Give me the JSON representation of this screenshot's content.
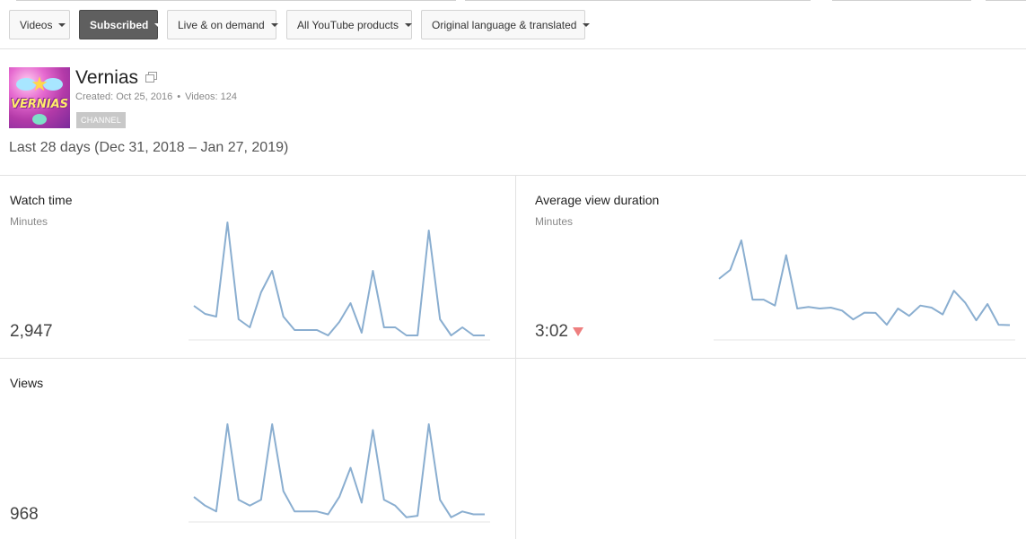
{
  "filters": [
    {
      "label": "Videos",
      "active": false
    },
    {
      "label": "Subscribed",
      "active": true
    },
    {
      "label": "Live & on demand",
      "active": false
    },
    {
      "label": "All YouTube products",
      "active": false
    },
    {
      "label": "Original language & translated",
      "active": false
    }
  ],
  "channel": {
    "name": "Vernias",
    "thumbnail_text": "VERNIAS",
    "created": "Created: Oct 25, 2016",
    "videos": "Videos: 124",
    "separator": "•",
    "badge": "CHANNEL"
  },
  "date_range": "Last 28 days (Dec 31, 2018 – Jan 27, 2019)",
  "metrics": {
    "watch_time": {
      "title": "Watch time",
      "unit": "Minutes",
      "value": "2,947",
      "series": [
        12,
        9,
        8,
        43,
        7,
        4,
        17,
        25,
        8,
        3,
        3,
        3,
        1,
        6,
        13,
        2,
        25,
        4,
        4,
        1,
        1,
        40,
        7,
        1,
        4,
        1,
        1
      ]
    },
    "avg_view_duration": {
      "title": "Average view duration",
      "unit": "Minutes",
      "value": "3:02",
      "trend": "down",
      "trend_color": "#ee7f7f",
      "series": [
        20,
        23,
        33,
        13,
        13,
        11,
        28,
        10,
        10.5,
        10,
        10.3,
        9.3,
        6.3,
        8.6,
        8.5,
        4.5,
        10,
        7.5,
        11,
        10.3,
        8,
        16,
        12,
        6,
        11.5,
        4.5,
        4.4
      ]
    },
    "views": {
      "title": "Views",
      "value": "968",
      "series": [
        8,
        5,
        3,
        33,
        7,
        5,
        7,
        33,
        10,
        3,
        3,
        3,
        2,
        8,
        18,
        6,
        31,
        7,
        5,
        1,
        1.5,
        33,
        7,
        1,
        3,
        2,
        2
      ]
    }
  },
  "colors": {
    "line": "#8aaed0",
    "baseline": "#e6e6e6",
    "active_filter": "#5f5f5f"
  }
}
